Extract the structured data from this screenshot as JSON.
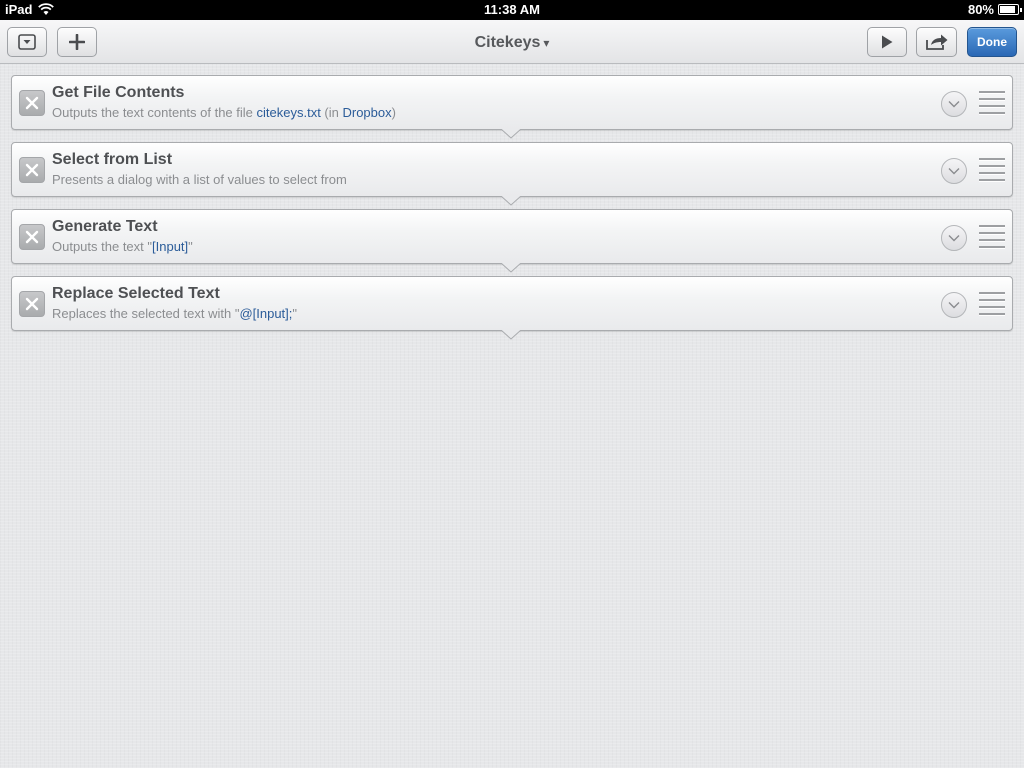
{
  "status_bar": {
    "device": "iPad",
    "time": "11:38 AM",
    "battery": "80%",
    "battery_level": 0.8
  },
  "toolbar": {
    "title": "Citekeys",
    "title_caret": "▾",
    "done_label": "Done",
    "icons": {
      "collapse": "collapse-icon",
      "add": "plus-icon",
      "run": "play-icon",
      "share": "share-icon"
    }
  },
  "actions": [
    {
      "title": "Get File Contents",
      "desc_1": "Outputs the text contents of the file ",
      "desc_link_1": "citekeys.txt",
      "desc_2": " (in ",
      "desc_link_2": "Dropbox",
      "desc_3": ")"
    },
    {
      "title": "Select from List",
      "desc_1": "Presents a dialog with a list of values to select from"
    },
    {
      "title": "Generate Text",
      "desc_1": "Outputs the text \"",
      "desc_link_1": "[Input]",
      "desc_2": "\""
    },
    {
      "title": "Replace Selected Text",
      "desc_1": "Replaces the selected text with \"",
      "desc_link_1": "@[Input];",
      "desc_2": "\""
    }
  ],
  "colors": {
    "accent": "#2b6ab8",
    "link": "#2b5c99",
    "background": "#e6e7e9"
  }
}
